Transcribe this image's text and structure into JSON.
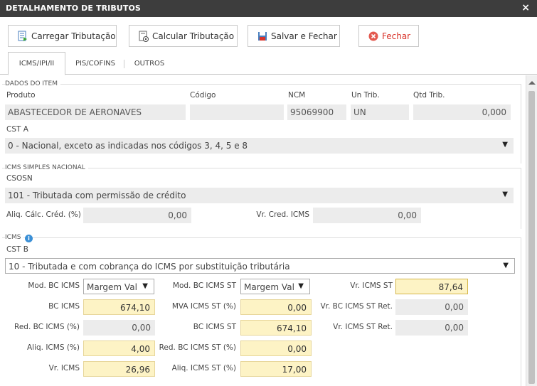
{
  "window": {
    "title": "DETALHAMENTO DE TRIBUTOS",
    "close": "×"
  },
  "toolbar": {
    "load": "Carregar Tributação",
    "calc": "Calcular Tributação",
    "save": "Salvar e Fechar",
    "close": "Fechar"
  },
  "tabs": [
    "ICMS/IPI/II",
    "PIS/COFINS",
    "OUTROS"
  ],
  "item": {
    "legend": "DADOS DO ITEM",
    "produto_label": "Produto",
    "produto": "ABASTECEDOR DE AERONAVES",
    "codigo_label": "Código",
    "codigo": "",
    "ncm_label": "NCM",
    "ncm": "95069900",
    "untrib_label": "Un Trib.",
    "untrib": "UN",
    "qtd_label": "Qtd Trib.",
    "qtd": "0,000",
    "csta_label": "CST A",
    "csta": "0 - Nacional, exceto as indicadas nos códigos 3, 4, 5 e 8"
  },
  "simples": {
    "legend": "ICMS SIMPLES NACIONAL",
    "csosn_label": "CSOSN",
    "csosn": "101 - Tributada com permissão de crédito",
    "aliq_label": "Aliq. Cálc. Créd. (%)",
    "aliq": "0,00",
    "vrcred_label": "Vr. Cred. ICMS",
    "vrcred": "0,00"
  },
  "icms": {
    "legend": "ICMS",
    "cstb_label": "CST B",
    "cstb": "10 - Tributada e com cobrança do ICMS por substituição tributária",
    "modbc_label": "Mod. BC ICMS",
    "modbc": "Margem Val",
    "modbcst_label": "Mod. BC ICMS ST",
    "modbcst": "Margem Val",
    "vricmsst_label": "Vr. ICMS ST",
    "vricmsst": "87,64",
    "bc_label": "BC ICMS",
    "bc": "674,10",
    "mva_label": "MVA ICMS ST (%)",
    "mva": "0,00",
    "vrbcstret_label": "Vr. BC ICMS ST Ret.",
    "vrbcstret": "0,00",
    "redbc_label": "Red. BC ICMS (%)",
    "redbc": "0,00",
    "bcst_label": "BC ICMS ST",
    "bcst": "674,10",
    "vricmsstret_label": "Vr. ICMS ST Ret.",
    "vricmsstret": "0,00",
    "aliqicms_label": "Aliq. ICMS (%)",
    "aliqicms": "4,00",
    "redbcst_label": "Red. BC ICMS ST (%)",
    "redbcst": "0,00",
    "vricms_label": "Vr. ICMS",
    "vricms": "26,96",
    "aliqst_label": "Aliq. ICMS ST (%)",
    "aliqst": "17,00"
  },
  "colors": {
    "titlebar": "#3d3d3d",
    "highlight": "#fdf3c5",
    "close": "#d9342b"
  }
}
